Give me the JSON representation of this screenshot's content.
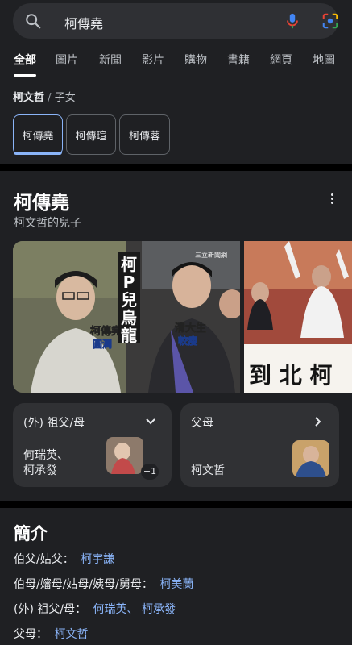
{
  "search": {
    "query": "柯傳堯"
  },
  "tabs": [
    "全部",
    "圖片",
    "新聞",
    "影片",
    "購物",
    "書籍",
    "網頁",
    "地圖"
  ],
  "breadcrumb": {
    "parent": "柯文哲",
    "separator": "/",
    "current": "子女"
  },
  "chips": [
    "柯傳堯",
    "柯傳瑄",
    "柯傳蓉"
  ],
  "entity": {
    "title": "柯傳堯",
    "subtitle": "柯文哲的兒子"
  },
  "images": {
    "img1": {
      "label_left_1": "柯傳堯",
      "label_left_2": "圓潤",
      "vertical": "柯P兒烏龍",
      "label_right_1": "清大生",
      "label_right_2": "較瘦",
      "watermark": "三立新聞網"
    },
    "img2": {
      "banner": "到  北  柯"
    }
  },
  "relations": [
    {
      "title": "(外) 祖父/母",
      "names": [
        "何瑞英、",
        "柯承發"
      ],
      "badge": "+1"
    },
    {
      "title": "父母",
      "names": [
        "柯文哲"
      ]
    }
  ],
  "intro": {
    "title": "簡介",
    "facts": [
      {
        "label": "伯父/姑父：",
        "values": [
          "柯宇謙"
        ]
      },
      {
        "label": "伯母/嬸母/姑母/姨母/舅母：",
        "values": [
          "柯美蘭"
        ]
      },
      {
        "label": "(外) 祖父/母：",
        "values": [
          "何瑞英、",
          "柯承發"
        ]
      },
      {
        "label": "父母：",
        "values": [
          "柯文哲"
        ]
      }
    ]
  },
  "colors": {
    "accent": "#8ab4f8",
    "card": "#1f2023",
    "surface": "#303134"
  }
}
